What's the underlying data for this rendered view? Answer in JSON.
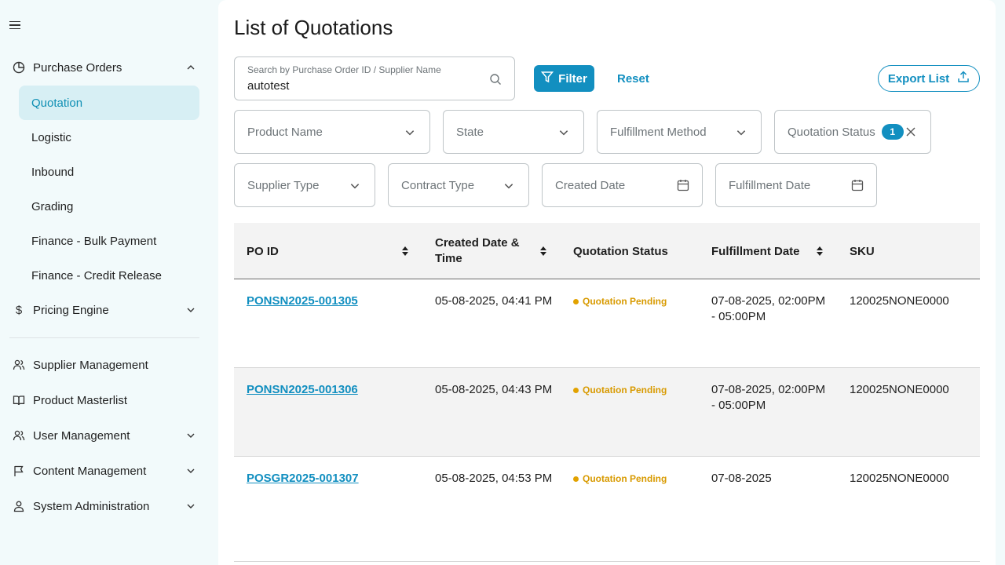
{
  "sidebar": {
    "groups": {
      "purchase_orders": "Purchase Orders",
      "pricing_engine": "Pricing Engine",
      "supplier_management": "Supplier Management",
      "product_masterlist": "Product Masterlist",
      "user_management": "User Management",
      "content_management": "Content Management",
      "system_administration": "System Administration"
    },
    "sub_items": [
      "Quotation",
      "Logistic",
      "Inbound",
      "Grading",
      "Finance - Bulk Payment",
      "Finance - Credit Release"
    ]
  },
  "page": {
    "title": "List of Quotations"
  },
  "search": {
    "placeholder": "Search by Purchase Order ID / Supplier Name",
    "value": "autotest"
  },
  "toolbar": {
    "filter_label": "Filter",
    "reset_label": "Reset",
    "export_label": "Export List"
  },
  "filters": {
    "product_name": "Product Name",
    "state": "State",
    "fulfillment_method": "Fulfillment Method",
    "quotation_status": "Quotation Status",
    "quotation_status_count": "1",
    "supplier_type": "Supplier Type",
    "contract_type": "Contract Type",
    "created_date": "Created Date",
    "fulfillment_date": "Fulfillment Date"
  },
  "table": {
    "headers": {
      "po_id": "PO ID",
      "created": "Created Date & Time",
      "status": "Quotation Status",
      "fulfillment": "Fulfillment Date",
      "sku": "SKU"
    },
    "rows": [
      {
        "po_id": "PONSN2025-001305",
        "created": "05-08-2025, 04:41 PM",
        "status": "Quotation Pending",
        "fulfillment": "07-08-2025, 02:00PM - 05:00PM",
        "sku": "120025NONE0000"
      },
      {
        "po_id": "PONSN2025-001306",
        "created": "05-08-2025, 04:43 PM",
        "status": "Quotation Pending",
        "fulfillment": "07-08-2025, 02:00PM - 05:00PM",
        "sku": "120025NONE0000"
      },
      {
        "po_id": "POSGR2025-001307",
        "created": "05-08-2025, 04:53 PM",
        "status": "Quotation Pending",
        "fulfillment": "07-08-2025",
        "sku": "120025NONE0000"
      }
    ]
  },
  "colors": {
    "accent": "#128fc0",
    "active_bg": "#d7eff4",
    "pending": "#d89a00"
  }
}
